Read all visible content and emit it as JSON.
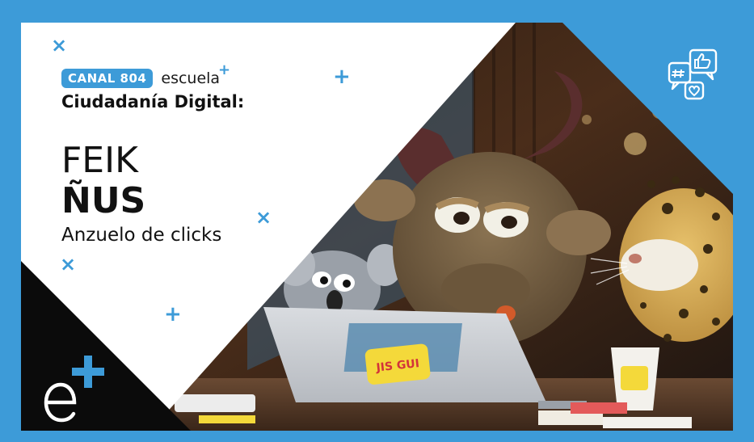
{
  "brand": {
    "badge": "CANAL 804",
    "escuela": "escuela",
    "escuela_plus": "+"
  },
  "episode": {
    "series": "Ciudadanía Digital:",
    "title_line1": "FEIK",
    "title_line2": "ÑUS",
    "subtitle": "Anzuelo de clicks"
  },
  "decorations": {
    "cross": "×",
    "plus": "+"
  },
  "sticker_text": "JIS GUI",
  "icons": {
    "logo": "e-plus-logo-icon",
    "social": "social-hashtag-like-heart-icon"
  },
  "colors": {
    "accent": "#3d9bd8",
    "black_corner": "#0b0b0b",
    "text": "#111111"
  }
}
